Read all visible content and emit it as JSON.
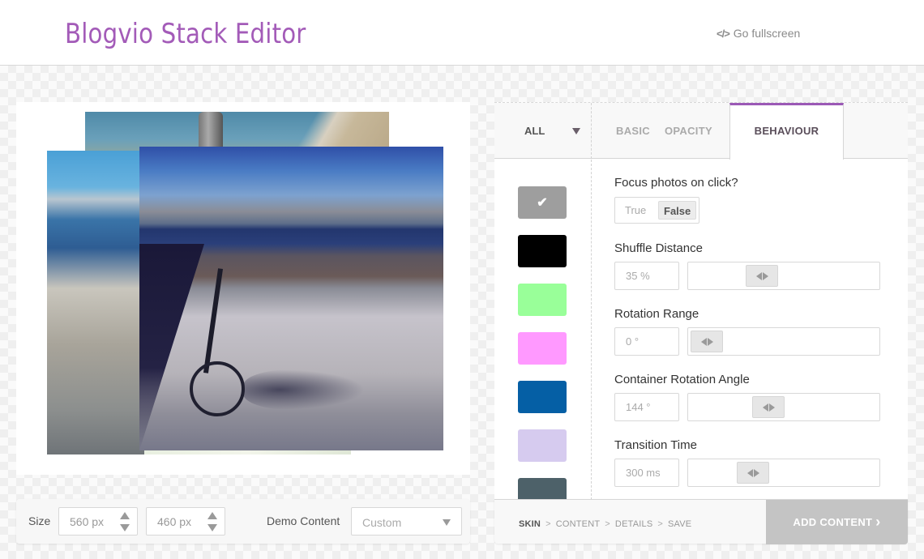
{
  "header": {
    "title": "Blogvio Stack Editor",
    "fullscreen_icon": "code-icon",
    "fullscreen_glyph": "</>",
    "fullscreen_label": "Go fullscreen"
  },
  "preview": {
    "photos": [
      {
        "name": "photo-back",
        "description": "seaside bike handlebar"
      },
      {
        "name": "photo-left",
        "description": "rocky coast and harbour"
      },
      {
        "name": "photo-front",
        "description": "folding bike on pier"
      }
    ]
  },
  "size_bar": {
    "size_label": "Size",
    "width_value": "560 px",
    "height_value": "460 px",
    "demo_label": "Demo Content",
    "demo_selected": "Custom"
  },
  "tabs": {
    "filter_label": "ALL",
    "items": [
      {
        "label": "BASIC",
        "active": false
      },
      {
        "label": "OPACITY",
        "active": false
      },
      {
        "label": "BEHAVIOUR",
        "active": true
      }
    ]
  },
  "skins": {
    "check_glyph": "✔",
    "swatches": [
      {
        "color": "#9e9e9e",
        "selected": true
      },
      {
        "color": "#000000",
        "selected": false
      },
      {
        "color": "#99ff99",
        "selected": false
      },
      {
        "color": "#ff99ff",
        "selected": false
      },
      {
        "color": "#055fa5",
        "selected": false
      },
      {
        "color": "#d6cbef",
        "selected": false
      },
      {
        "color": "#4d6169",
        "selected": false
      }
    ]
  },
  "settings": {
    "focus": {
      "label": "Focus photos on click?",
      "options": [
        "True",
        "False"
      ],
      "selected": "False"
    },
    "shuffle": {
      "label": "Shuffle Distance",
      "value": "35 %",
      "slider_fraction": 0.36
    },
    "rotation": {
      "label": "Rotation Range",
      "value": "0 °",
      "slider_fraction": 0.0
    },
    "container": {
      "label": "Container Rotation Angle",
      "value": "144 °",
      "slider_fraction": 0.4
    },
    "transition": {
      "label": "Transition Time",
      "value": "300 ms",
      "slider_fraction": 0.3
    }
  },
  "footer": {
    "steps": [
      "SKIN",
      "CONTENT",
      "DETAILS",
      "SAVE"
    ],
    "active_step": "SKIN",
    "separator": ">",
    "add_button_label": "ADD CONTENT",
    "add_button_icon": "chevron-right-icon",
    "add_button_glyph": "›"
  },
  "colors": {
    "accent": "#9b59b6",
    "button_disabled": "#c4c4c4"
  }
}
